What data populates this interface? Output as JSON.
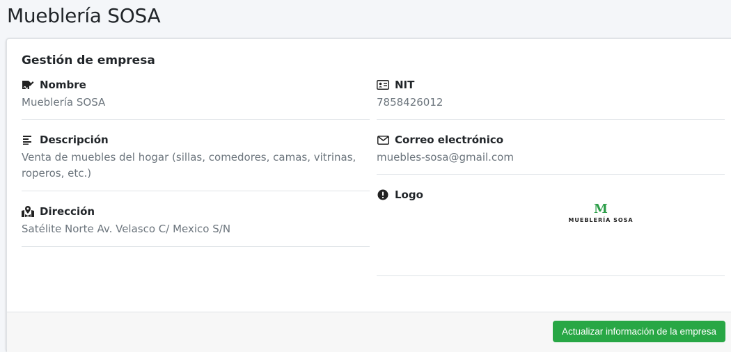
{
  "page": {
    "title": "Mueblería SOSA"
  },
  "card": {
    "title": "Gestión de empresa",
    "fields": {
      "nombre": {
        "label": "Nombre",
        "value": "Mueblería SOSA",
        "icon": "signature-icon"
      },
      "nit": {
        "label": "NIT",
        "value": "7858426012",
        "icon": "id-card-icon"
      },
      "descripcion": {
        "label": "Descripción",
        "value_line1": "Venta de muebles del hogar (sillas, comedores, camas, vitrinas,",
        "value_line2": "roperos, etc.)",
        "icon": "align-left-icon"
      },
      "correo": {
        "label": "Correo electrónico",
        "value": "muebles-sosa@gmail.com",
        "icon": "envelope-icon"
      },
      "direccion": {
        "label": "Dirección",
        "value": "Satélite Norte Av. Velasco C/ Mexico S/N",
        "icon": "map-marked-icon"
      },
      "logo": {
        "label": "Logo",
        "icon": "exclamation-circle-icon",
        "logo_mark": "M",
        "logo_text": "MUEBLERÍA SOSA"
      }
    },
    "footer": {
      "update_button": "Actualizar información de la empresa"
    }
  },
  "colors": {
    "primary_text": "#212529",
    "muted_text": "#6c757d",
    "success": "#28a745",
    "logo_green": "#2e9e4a"
  }
}
